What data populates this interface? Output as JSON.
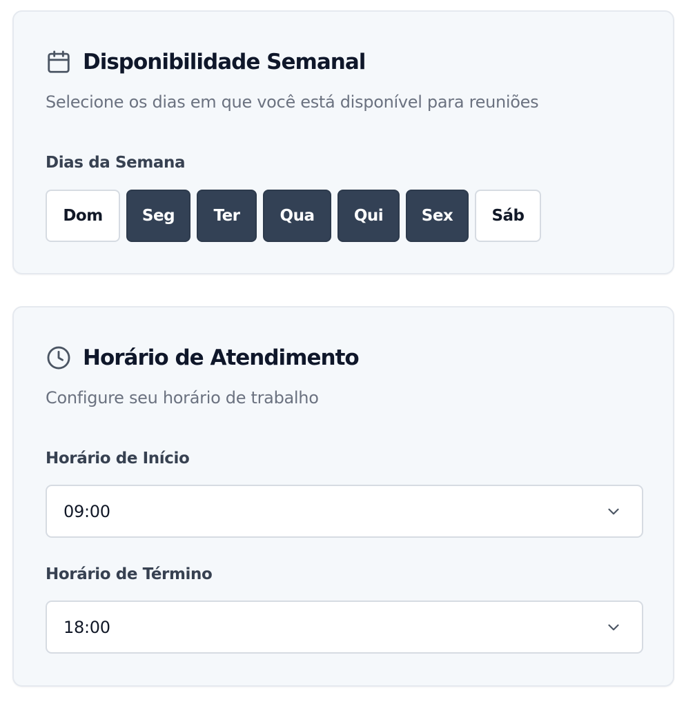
{
  "availability": {
    "icon": "calendar-icon",
    "title": "Disponibilidade Semanal",
    "subtitle": "Selecione os dias em que você está disponível para reuniões",
    "days_label": "Dias da Semana",
    "days": [
      {
        "label": "Dom",
        "selected": false
      },
      {
        "label": "Seg",
        "selected": true
      },
      {
        "label": "Ter",
        "selected": true
      },
      {
        "label": "Qua",
        "selected": true
      },
      {
        "label": "Qui",
        "selected": true
      },
      {
        "label": "Sex",
        "selected": true
      },
      {
        "label": "Sáb",
        "selected": false
      }
    ]
  },
  "hours": {
    "icon": "clock-icon",
    "title": "Horário de Atendimento",
    "subtitle": "Configure seu horário de trabalho",
    "start_label": "Horário de Início",
    "start_value": "09:00",
    "end_label": "Horário de Término",
    "end_value": "18:00"
  },
  "colors": {
    "card_background": "#f5f8fb",
    "selected_day": "#334155",
    "muted_text": "#6b7280"
  }
}
